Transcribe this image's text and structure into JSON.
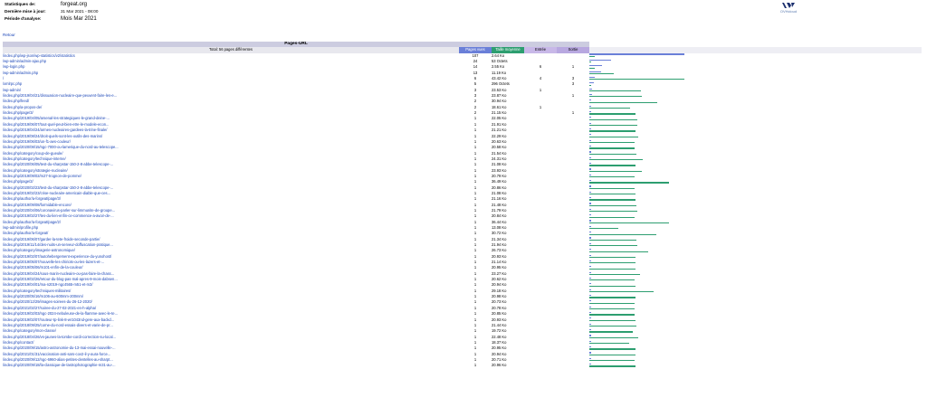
{
  "header": {
    "rows": [
      {
        "label": "Statistiques de:",
        "value": "forgeat.org"
      },
      {
        "label": "Dernière mise à jour:",
        "value": "31 Mar 2021 - 08:00"
      },
      {
        "label": "Période d'analyse:",
        "value": "Mois Mar 2021"
      }
    ]
  },
  "logo": {
    "text": "OVHcloud"
  },
  "back_link": "Retour",
  "table": {
    "title": "Pages-URL",
    "total": "Total: 56 pages différentes",
    "col_pages": "Pages vues",
    "col_bandwidth": "Taille moyenne",
    "col_entry": "Entrée",
    "col_exit": "Sortie",
    "colors": {
      "pages": "#6a7fd8",
      "bandwidth": "#2d9e70"
    },
    "max_pages": 107,
    "max_kb": 43.42,
    "rows": [
      {
        "url": "/index.php/wp-json/wp-statistics/v2/statistics",
        "pages": 107,
        "bw": "2.64 Ko",
        "kb": 2.64,
        "entry": "",
        "exit": ""
      },
      {
        "url": "/wp-admin/admin-ajax.php",
        "pages": 24,
        "bw": "53 Octets",
        "kb": 0.05,
        "entry": "",
        "exit": ""
      },
      {
        "url": "/wp-login.php",
        "pages": 14,
        "bw": "2.55 Ko",
        "kb": 2.55,
        "entry": "6",
        "exit": "1"
      },
      {
        "url": "/wp-admin/admin.php",
        "pages": 13,
        "bw": "11.19 Ko",
        "kb": 11.19,
        "entry": "",
        "exit": ""
      },
      {
        "url": "/",
        "pages": 6,
        "bw": "43.42 Ko",
        "kb": 43.42,
        "entry": "4",
        "exit": "3"
      },
      {
        "url": "/xmlrpc.php",
        "pages": 5,
        "bw": "296 Octets",
        "kb": 0.29,
        "entry": "",
        "exit": "3"
      },
      {
        "url": "/wp-admin/",
        "pages": 3,
        "bw": "23.53 Ko",
        "kb": 23.53,
        "entry": "1",
        "exit": ""
      },
      {
        "url": "/index.php/2019/04/21/dissuasion-nucleaire-que-peuvent-faire-les-e...",
        "pages": 3,
        "bw": "23.87 Ko",
        "kb": 23.87,
        "entry": "",
        "exit": "1"
      },
      {
        "url": "/index.php/feed/",
        "pages": 2,
        "bw": "30.94 Ko",
        "kb": 30.94,
        "entry": "",
        "exit": ""
      },
      {
        "url": "/index.php/a-propos-de/",
        "pages": 2,
        "bw": "18.61 Ko",
        "kb": 18.61,
        "entry": "1",
        "exit": ""
      },
      {
        "url": "/index.php/page/3/",
        "pages": 2,
        "bw": "21.15 Ko",
        "kb": 21.15,
        "entry": "",
        "exit": "1"
      },
      {
        "url": "/index.php/2019/04/05/arsenal-les-strategiques-le-grand-deine-...",
        "pages": 1,
        "bw": "22.05 Ko",
        "kb": 22.05,
        "entry": "",
        "exit": ""
      },
      {
        "url": "/index.php/2019/06/07/tout-quel-peut-bien-etre-le-modele-econ...",
        "pages": 1,
        "bw": "21.91 Ko",
        "kb": 21.91,
        "entry": "",
        "exit": ""
      },
      {
        "url": "/index.php/2019/04/24/armes-nucleaires-gardees-la-trine-finale/",
        "pages": 1,
        "bw": "21.21 Ko",
        "kb": 21.21,
        "entry": "",
        "exit": ""
      },
      {
        "url": "/index.php/2019/08/24/droit-quels-sont-les-outils-des-marins/",
        "pages": 1,
        "bw": "22.29 Ko",
        "kb": 22.29,
        "entry": "",
        "exit": ""
      },
      {
        "url": "/index.php/2019/06/03/un-f1-aes-couleur/",
        "pages": 1,
        "bw": "20.63 Ko",
        "kb": 20.63,
        "entry": "",
        "exit": ""
      },
      {
        "url": "/index.php/2020/08/15/ngc-7000-ou-lamerique-du-nord-au-telescope...",
        "pages": 1,
        "bw": "20.58 Ko",
        "kb": 20.58,
        "entry": "",
        "exit": ""
      },
      {
        "url": "/index.php/category/coup-de-gueule/",
        "pages": 1,
        "bw": "21.54 Ko",
        "kb": 21.54,
        "entry": "",
        "exit": ""
      },
      {
        "url": "/index.php/category/technique-interne/",
        "pages": 1,
        "bw": "24.31 Ko",
        "kb": 24.31,
        "entry": "",
        "exit": ""
      },
      {
        "url": "/index.php/2020/06/05/test-du-sharpstar-150-2-8-abbe-telescope-...",
        "pages": 1,
        "bw": "21.08 Ko",
        "kb": 21.08,
        "entry": "",
        "exit": ""
      },
      {
        "url": "/index.php/category/strategie-nucleaire/",
        "pages": 1,
        "bw": "23.93 Ko",
        "kb": 23.93,
        "entry": "",
        "exit": ""
      },
      {
        "url": "/index.php/2019/09/02/m27-trognon-de-pomme/",
        "pages": 1,
        "bw": "20.79 Ko",
        "kb": 20.79,
        "entry": "",
        "exit": ""
      },
      {
        "url": "/index.php/page/2/",
        "pages": 1,
        "bw": "36.49 Ko",
        "kb": 36.49,
        "entry": "",
        "exit": ""
      },
      {
        "url": "/index.php/2020/02/23/test-du-sharpstar-150-2-8-abbe-telescope-...",
        "pages": 1,
        "bw": "20.86 Ko",
        "kb": 20.86,
        "entry": "",
        "exit": ""
      },
      {
        "url": "/index.php/2019/02/23/crise-nucleaire-americain-diable-que-ces...",
        "pages": 1,
        "bw": "21.08 Ko",
        "kb": 21.08,
        "entry": "",
        "exit": ""
      },
      {
        "url": "/index.php/author/a-forgeat/page/3/",
        "pages": 1,
        "bw": "21.16 Ko",
        "kb": 21.16,
        "entry": "",
        "exit": ""
      },
      {
        "url": "/index.php/2019/09/08/formidable-encore/",
        "pages": 1,
        "bw": "21.48 Ko",
        "kb": 21.48,
        "entry": "",
        "exit": ""
      },
      {
        "url": "/index.php/2020/04/06/coronavirus-parler-sur-limmunite-de-groupe...",
        "pages": 1,
        "bw": "21.79 Ko",
        "kb": 21.79,
        "entry": "",
        "exit": ""
      },
      {
        "url": "/index.php/2019/02/27/tes-du-lien-enfin-ce-commence-a-avoir-de-...",
        "pages": 1,
        "bw": "20.84 Ko",
        "kb": 20.84,
        "entry": "",
        "exit": ""
      },
      {
        "url": "/index.php/author/a-forgeat/page/2/",
        "pages": 1,
        "bw": "36.44 Ko",
        "kb": 36.44,
        "entry": "",
        "exit": ""
      },
      {
        "url": "/wp-admin/profile.php",
        "pages": 1,
        "bw": "13.08 Ko",
        "kb": 13.08,
        "entry": "",
        "exit": ""
      },
      {
        "url": "/index.php/author/a-forgeat/",
        "pages": 1,
        "bw": "30.72 Ko",
        "kb": 30.72,
        "entry": "",
        "exit": ""
      },
      {
        "url": "/index.php/2019/06/07/garder-la-tete-froide-seconde-partie/",
        "pages": 1,
        "bw": "21.34 Ko",
        "kb": 21.34,
        "entry": "",
        "exit": ""
      },
      {
        "url": "/index.php/2019/11/14/des-nuits-un-serveur-doffuscation-pratique...",
        "pages": 1,
        "bw": "21.94 Ko",
        "kb": 21.94,
        "entry": "",
        "exit": ""
      },
      {
        "url": "/index.php/category/imagerie-astronomique/",
        "pages": 1,
        "bw": "26.73 Ko",
        "kb": 26.73,
        "entry": "",
        "exit": ""
      },
      {
        "url": "/index.php/2019/02/07/autohebergement-experience-du-yunohost/",
        "pages": 1,
        "bw": "20.93 Ko",
        "kb": 20.93,
        "entry": "",
        "exit": ""
      },
      {
        "url": "/index.php/2019/05/07/nouvelle-les-chiriots-ou-les-lazers-et-...",
        "pages": 1,
        "bw": "21.14 Ko",
        "kb": 21.14,
        "entry": "",
        "exit": ""
      },
      {
        "url": "/index.php/2019/05/06/m101-enfin-de-la-couleur/",
        "pages": 1,
        "bw": "20.95 Ko",
        "kb": 20.95,
        "entry": "",
        "exit": ""
      },
      {
        "url": "/index.php/2019/04/24/sous-marin-nucleaire-ou-pas-faire-la-chass...",
        "pages": 1,
        "bw": "23.27 Ko",
        "kb": 23.27,
        "entry": "",
        "exit": ""
      },
      {
        "url": "/index.php/2019/02/26/retour-du-blog-pas-mal-apres-9-mois-dabsen...",
        "pages": 1,
        "bw": "20.62 Ko",
        "kb": 20.62,
        "entry": "",
        "exit": ""
      },
      {
        "url": "/index.php/2019/04/01/ma-n2019-ngc4565-m51-et-m3/",
        "pages": 1,
        "bw": "20.94 Ko",
        "kb": 20.94,
        "entry": "",
        "exit": ""
      },
      {
        "url": "/index.php/category/techniques-militaires/",
        "pages": 1,
        "bw": "29.18 Ko",
        "kb": 29.18,
        "entry": "",
        "exit": ""
      },
      {
        "url": "/index.php/2020/05/16/m106-au-600mm-200mm/",
        "pages": 1,
        "bw": "20.98 Ko",
        "kb": 20.98,
        "entry": "",
        "exit": ""
      },
      {
        "url": "/index.php/2020/12/29/images-soirees-du-26-12-2020/",
        "pages": 1,
        "bw": "20.73 Ko",
        "kb": 20.73,
        "entry": "",
        "exit": ""
      },
      {
        "url": "/index.php/2021/02/27/soiree-du-27-02-2021-en-h-alpha/",
        "pages": 1,
        "bw": "20.78 Ko",
        "kb": 20.78,
        "entry": "",
        "exit": ""
      },
      {
        "url": "/index.php/2019/02/03/ngc-2024-nebuleuse-de-la-flamme-avec-le-te...",
        "pages": 1,
        "bw": "20.85 Ko",
        "kb": 20.85,
        "entry": "",
        "exit": ""
      },
      {
        "url": "/index.php/2019/02/07/routeur-tp-link-8-wr1043nd-gere-aux-backd...",
        "pages": 1,
        "bw": "20.93 Ko",
        "kb": 20.93,
        "entry": "",
        "exit": ""
      },
      {
        "url": "/index.php/2018/09/25/corne-du-nord-essais-divers-et-varie-de-pr...",
        "pages": 1,
        "bw": "21.44 Ko",
        "kb": 21.44,
        "entry": "",
        "exit": ""
      },
      {
        "url": "/index.php/category/mon-classe/",
        "pages": 1,
        "bw": "19.72 Ko",
        "kb": 19.72,
        "entry": "",
        "exit": ""
      },
      {
        "url": "/index.php/2018/04/26/vs-jaunes-la-tombe-cordi-correction-su-local...",
        "pages": 1,
        "bw": "22.48 Ko",
        "kb": 22.48,
        "entry": "",
        "exit": ""
      },
      {
        "url": "/index.php/contact/",
        "pages": 1,
        "bw": "18.37 Ko",
        "kb": 18.37,
        "entry": "",
        "exit": ""
      },
      {
        "url": "/index.php/2020/09/15/astro-astronomie-du-13-mai-essai-nouvelle-...",
        "pages": 1,
        "bw": "20.95 Ko",
        "kb": 20.95,
        "entry": "",
        "exit": ""
      },
      {
        "url": "/index.php/2021/01/31/vaccination-anti-sars-cov2-il-y-aura-force...",
        "pages": 1,
        "bw": "20.94 Ko",
        "kb": 20.94,
        "entry": "",
        "exit": ""
      },
      {
        "url": "/index.php/2020/09/12/ngc-6960-alias-petites-dentelles-au-sharpt...",
        "pages": 1,
        "bw": "20.71 Ko",
        "kb": 20.71,
        "entry": "",
        "exit": ""
      },
      {
        "url": "/index.php/2020/09/18/la-classique-de-lastrophotographie-m31-au-...",
        "pages": 1,
        "bw": "20.96 Ko",
        "kb": 20.96,
        "entry": "",
        "exit": ""
      }
    ]
  }
}
